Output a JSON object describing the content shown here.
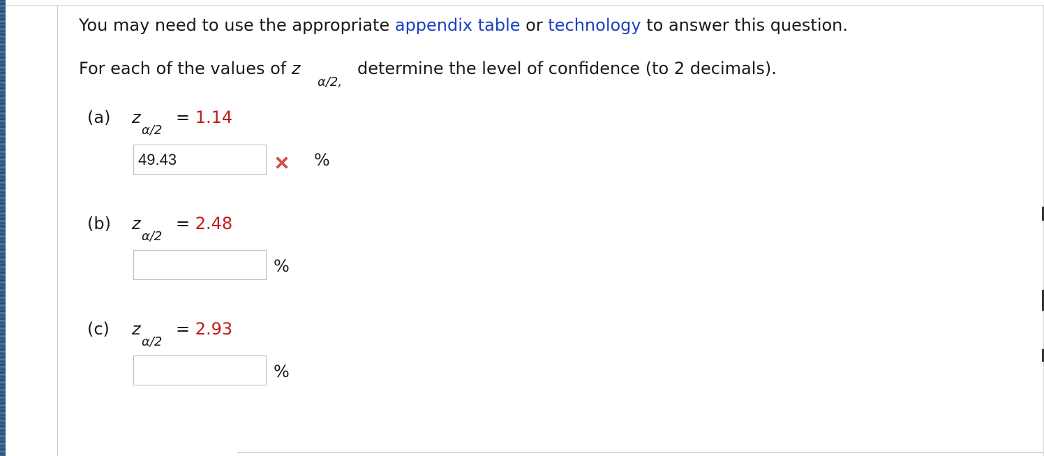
{
  "intro": {
    "prefix": "You may need to use the appropriate ",
    "link1": "appendix table",
    "middle": " or ",
    "link2": "technology",
    "suffix": " to answer this question."
  },
  "prompt": {
    "before": "For each of the values of ",
    "z": "z",
    "subscript": "α/2",
    "comma": ",",
    "after": " determine the level of confidence (to 2 decimals)."
  },
  "parts": [
    {
      "label": "(a)",
      "z": "z",
      "subscript": "α/2",
      "equals": "=",
      "value": "1.14",
      "answer": "49.43",
      "unit": "%",
      "status": "incorrect"
    },
    {
      "label": "(b)",
      "z": "z",
      "subscript": "α/2",
      "equals": "=",
      "value": "2.48",
      "answer": "",
      "unit": "%",
      "status": "unanswered"
    },
    {
      "label": "(c)",
      "z": "z",
      "subscript": "α/2",
      "equals": "=",
      "value": "2.93",
      "answer": "",
      "unit": "%",
      "status": "unanswered"
    }
  ],
  "colors": {
    "link": "#1d3fbf",
    "value": "#c21b17",
    "wrong_icon": "#e05252"
  },
  "icons": {
    "incorrect": "x-mark-icon"
  }
}
